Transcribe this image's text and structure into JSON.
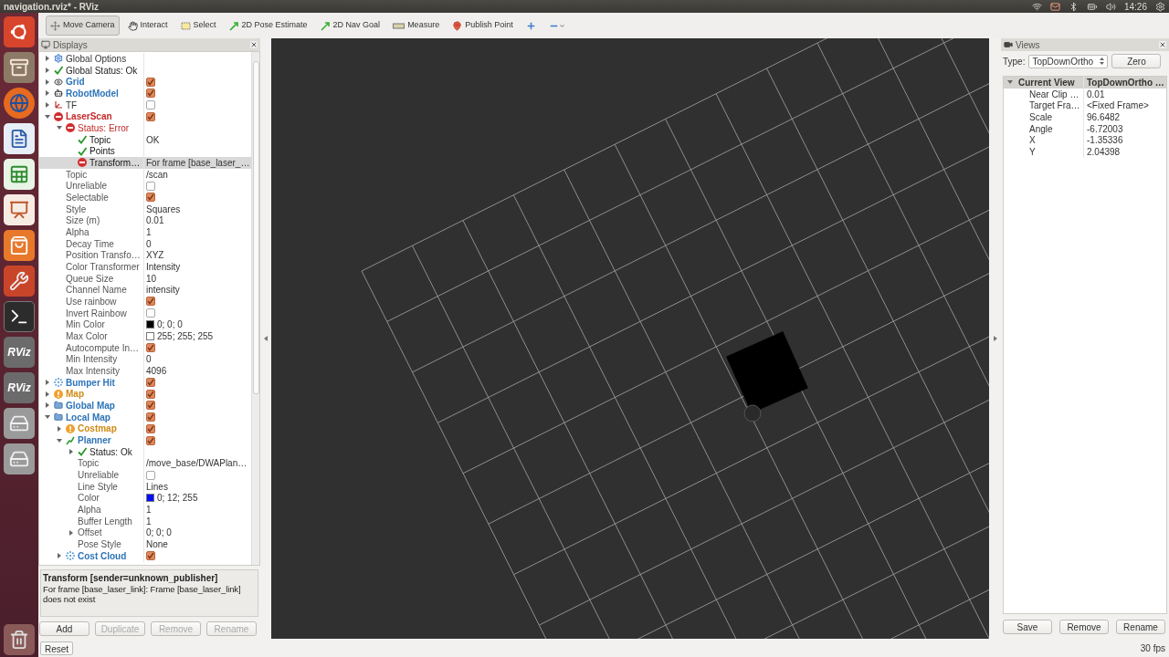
{
  "window": {
    "title": "navigation.rviz* - RViz"
  },
  "tray": {
    "time": "14:26"
  },
  "launcher": [
    {
      "kind": "ubuntu"
    },
    {
      "kind": "files"
    },
    {
      "kind": "browser"
    },
    {
      "kind": "writer"
    },
    {
      "kind": "calc"
    },
    {
      "kind": "impress"
    },
    {
      "kind": "store"
    },
    {
      "kind": "settings"
    },
    {
      "kind": "terminal"
    },
    {
      "kind": "rviz",
      "label": "RViz"
    },
    {
      "kind": "rviz",
      "label": "RViz"
    },
    {
      "kind": "drive"
    },
    {
      "kind": "drive"
    },
    {
      "kind": "trash"
    }
  ],
  "toolbar": [
    {
      "label": "Move Camera",
      "selected": true
    },
    {
      "label": "Interact",
      "selected": false
    },
    {
      "label": "Select",
      "selected": false
    },
    {
      "label": "2D Pose Estimate",
      "selected": false
    },
    {
      "label": "2D Nav Goal",
      "selected": false
    },
    {
      "label": "Measure",
      "selected": false
    },
    {
      "label": "Publish Point",
      "selected": false
    },
    {
      "selected": false
    },
    {
      "selected": false
    }
  ],
  "displays": {
    "title": "Displays",
    "items": [
      {
        "label": "Global Options",
        "kind": "options",
        "expanded": false,
        "selected": false
      },
      {
        "label": "Global Status: Ok",
        "kind": "status",
        "error": false,
        "warning": false,
        "expanded": false,
        "selected": false
      },
      {
        "label": "Grid",
        "kind": "grid",
        "error": false,
        "warning": false,
        "expanded": false,
        "checked": true,
        "selected": false
      },
      {
        "label": "RobotModel",
        "kind": "robot",
        "error": false,
        "warning": false,
        "expanded": false,
        "checked": true,
        "selected": false
      },
      {
        "label": "TF",
        "kind": "tf",
        "error": false,
        "warning": false,
        "expanded": false,
        "checked": false,
        "selected": false
      },
      {
        "label": "LaserScan",
        "kind": "laser",
        "error": true,
        "expanded": true,
        "checked": true,
        "selected": false,
        "children": [
          {
            "label": "Status: Error",
            "kind": "status",
            "error": true,
            "expanded": true,
            "selected": false,
            "children": [
              {
                "label": "Topic",
                "kind": "check",
                "error": false,
                "warning": false,
                "value": "OK",
                "selected": false
              },
              {
                "label": "Points",
                "kind": "check",
                "error": false,
                "warning": false,
                "selected": false
              },
              {
                "label": "Transform…",
                "kind": "check",
                "error": true,
                "value": "For frame [base_laser_…",
                "selected": true
              }
            ]
          },
          {
            "label": "Topic",
            "kind": "property",
            "value": "/scan",
            "selected": false
          },
          {
            "label": "Unreliable",
            "kind": "property",
            "checked": false,
            "selected": false
          },
          {
            "label": "Selectable",
            "kind": "property",
            "checked": true,
            "selected": false
          },
          {
            "label": "Style",
            "kind": "property",
            "value": "Squares",
            "selected": false
          },
          {
            "label": "Size (m)",
            "kind": "property",
            "value": "0.01",
            "selected": false
          },
          {
            "label": "Alpha",
            "kind": "property",
            "value": "1",
            "selected": false
          },
          {
            "label": "Decay Time",
            "kind": "property",
            "value": "0",
            "selected": false
          },
          {
            "label": "Position Transfo…",
            "kind": "property",
            "value": "XYZ",
            "selected": false
          },
          {
            "label": "Color Transformer",
            "kind": "property",
            "value": "Intensity",
            "selected": false
          },
          {
            "label": "Queue Size",
            "kind": "property",
            "value": "10",
            "selected": false
          },
          {
            "label": "Channel Name",
            "kind": "property",
            "value": "intensity",
            "selected": false
          },
          {
            "label": "Use rainbow",
            "kind": "property",
            "checked": true,
            "selected": false
          },
          {
            "label": "Invert Rainbow",
            "kind": "property",
            "checked": false,
            "selected": false
          },
          {
            "label": "Min Color",
            "kind": "property",
            "color": "#000000",
            "value": "0; 0; 0",
            "selected": false
          },
          {
            "label": "Max Color",
            "kind": "property",
            "color": "#ffffff",
            "value": "255; 255; 255",
            "selected": false
          },
          {
            "label": "Autocompute In…",
            "kind": "property",
            "checked": true,
            "selected": false
          },
          {
            "label": "Min Intensity",
            "kind": "property",
            "value": "0",
            "selected": false
          },
          {
            "label": "Max Intensity",
            "kind": "property",
            "value": "4096",
            "selected": false
          }
        ]
      },
      {
        "label": "Bumper Hit",
        "kind": "cloud",
        "error": false,
        "warning": false,
        "expanded": false,
        "checked": true,
        "selected": false
      },
      {
        "label": "Map",
        "kind": "map",
        "error": false,
        "warning": true,
        "expanded": false,
        "checked": true,
        "selected": false
      },
      {
        "label": "Global Map",
        "kind": "group",
        "error": false,
        "warning": false,
        "expanded": false,
        "checked": true,
        "selected": false
      },
      {
        "label": "Local Map",
        "kind": "group",
        "error": false,
        "warning": false,
        "expanded": true,
        "checked": true,
        "selected": false,
        "children": [
          {
            "label": "Costmap",
            "kind": "map",
            "error": false,
            "warning": true,
            "expanded": false,
            "checked": true,
            "selected": false
          },
          {
            "label": "Planner",
            "kind": "path",
            "error": false,
            "warning": false,
            "expanded": true,
            "checked": true,
            "selected": false,
            "children": [
              {
                "label": "Status: Ok",
                "kind": "status",
                "error": false,
                "warning": false,
                "expanded": false,
                "selected": false
              },
              {
                "label": "Topic",
                "kind": "property",
                "value": "/move_base/DWAPlan…",
                "selected": false
              },
              {
                "label": "Unreliable",
                "kind": "property",
                "checked": false,
                "selected": false
              },
              {
                "label": "Line Style",
                "kind": "property",
                "value": "Lines",
                "selected": false
              },
              {
                "label": "Color",
                "kind": "property",
                "color": "#000cff",
                "value": "0; 12; 255",
                "selected": false
              },
              {
                "label": "Alpha",
                "kind": "property",
                "value": "1",
                "selected": false
              },
              {
                "label": "Buffer Length",
                "kind": "property",
                "value": "1",
                "selected": false
              },
              {
                "label": "Offset",
                "kind": "property",
                "expanded": false,
                "value": "0; 0; 0",
                "selected": false
              },
              {
                "label": "Pose Style",
                "kind": "property",
                "value": "None",
                "selected": false
              }
            ]
          },
          {
            "label": "Cost Cloud",
            "kind": "cloud",
            "error": false,
            "warning": false,
            "expanded": false,
            "checked": true,
            "selected": false
          }
        ]
      }
    ]
  },
  "description": {
    "title": "Transform [sender=unknown_publisher]",
    "text": "For frame [base_laser_link]: Frame [base_laser_link] does not exist"
  },
  "display_buttons": [
    {
      "label": "Add",
      "disabled": false
    },
    {
      "label": "Duplicate",
      "disabled": true
    },
    {
      "label": "Remove",
      "disabled": true
    },
    {
      "label": "Rename",
      "disabled": true
    }
  ],
  "reset": "Reset",
  "views": {
    "title": "Views",
    "type_label": "Type:",
    "type_value": "TopDownOrtho",
    "zero": "Zero",
    "current": {
      "label": "Current View",
      "value": "TopDownOrtho …",
      "expanded": true
    },
    "properties": [
      {
        "label": "Near Clip …",
        "value": "0.01"
      },
      {
        "label": "Target Fra…",
        "value": "<Fixed Frame>"
      },
      {
        "label": "Scale",
        "value": "96.6482"
      },
      {
        "label": "Angle",
        "value": "-6.72003"
      },
      {
        "label": "X",
        "value": "-1.35336"
      },
      {
        "label": "Y",
        "value": "2.04398"
      }
    ],
    "buttons": [
      {
        "label": "Save",
        "disabled": false
      },
      {
        "label": "Remove",
        "disabled": false
      },
      {
        "label": "Rename",
        "disabled": false
      }
    ]
  },
  "fps": "30 fps"
}
